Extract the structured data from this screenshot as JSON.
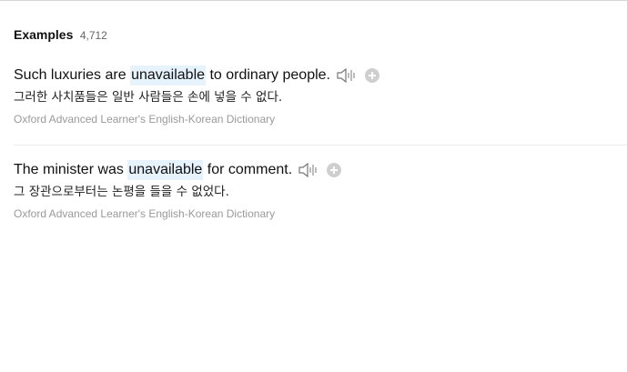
{
  "section": {
    "title": "Examples",
    "count": "4,712"
  },
  "examples": [
    {
      "before": "Such luxuries are ",
      "highlight": "unavailable",
      "after": " to ordinary people.",
      "translation": "그러한 사치품들은 일반 사람들은 손에 넣을 수 없다.",
      "source": "Oxford Advanced Learner's English-Korean Dictionary"
    },
    {
      "before": "The minister was ",
      "highlight": "unavailable",
      "after": " for comment.",
      "translation": "그 장관으로부터는 논평을 들을 수 없었다.",
      "source": "Oxford Advanced Learner's English-Korean Dictionary"
    }
  ],
  "icons": {
    "speaker": "speaker-icon",
    "add": "plus-circle-icon"
  },
  "colors": {
    "highlight_bg": "#e6f2fc",
    "source_text": "#9a9a9a",
    "add_button": "#cfcfcf"
  }
}
